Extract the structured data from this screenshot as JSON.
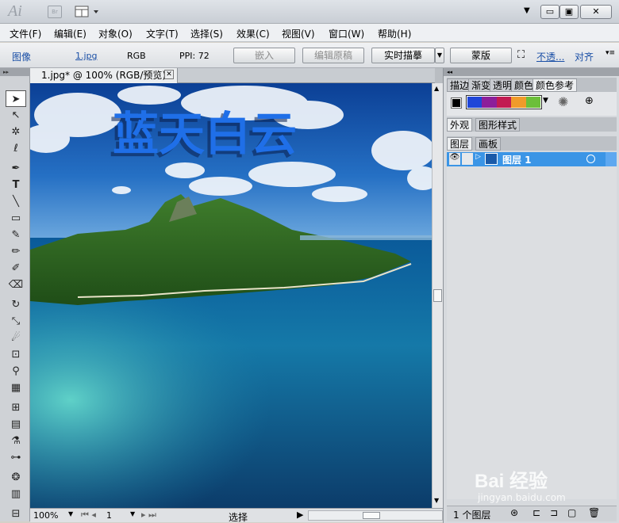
{
  "app": {
    "logo": "Ai",
    "bridge_label": "Br"
  },
  "menu": [
    "文件(F)",
    "编辑(E)",
    "对象(O)",
    "文字(T)",
    "选择(S)",
    "效果(C)",
    "视图(V)",
    "窗口(W)",
    "帮助(H)"
  ],
  "control": {
    "object_type": "图像",
    "file_link": "1.jpg",
    "color_mode": "RGB",
    "ppi": "PPI: 72",
    "embed": "嵌入",
    "edit_original": "编辑原稿",
    "live_trace": "实时描摹",
    "mask": "蒙版",
    "opacity": "不透...",
    "align": "对齐"
  },
  "document": {
    "tab_title": "1.jpg* @ 100% (RGB/预览)",
    "image_text": "蓝天白云"
  },
  "status": {
    "zoom": "100%",
    "artboard": "1",
    "tool": "选择"
  },
  "panels": {
    "top_tabs": [
      "描边",
      "渐变",
      "透明",
      "颜色",
      "颜色参考"
    ],
    "mid_tabs": [
      "外观",
      "图形样式"
    ],
    "layer_tabs": [
      "图层",
      "画板"
    ],
    "layer_name": "图层 1",
    "layer_count": "1 个图层"
  },
  "colors": {
    "accent": "#1f6fe8",
    "selection": "#3b95e6"
  },
  "watermark": {
    "text": "Bai 经验",
    "url": "jingyan.baidu.com"
  }
}
